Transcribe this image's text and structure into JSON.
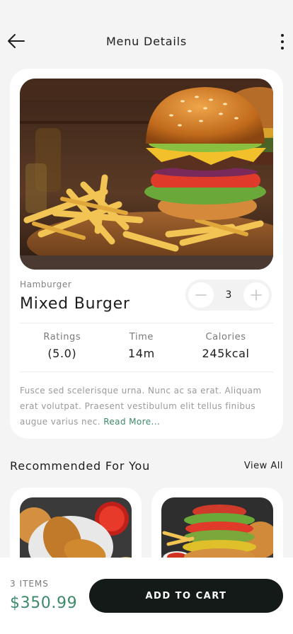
{
  "header": {
    "title": "Menu Details"
  },
  "item": {
    "category": "Hamburger",
    "name": "Mixed Burger",
    "quantity": "3",
    "stats": [
      {
        "label": "Ratings",
        "value": "(5.0)"
      },
      {
        "label": "Time",
        "value": "14m"
      },
      {
        "label": "Calories",
        "value": "245kcal"
      }
    ],
    "description": "Fusce sed scelerisque urna. Nunc ac sa erat. Aliquam erat volutpat. Praesent vestibulum elit tellus finibus augue varius nec.",
    "read_more": "Read More..."
  },
  "recommended": {
    "title": "Recommended For You",
    "view_all": "View All"
  },
  "cart": {
    "items_count": "3 ITEMS",
    "price": "$350.99",
    "button_label": "ADD TO CART"
  },
  "colors": {
    "accent": "#3d8a6b",
    "dark_button": "#141a17",
    "background": "#f4f4f4"
  },
  "icons": [
    "arrow-left-icon",
    "more-vertical-icon",
    "minus-icon",
    "plus-icon"
  ]
}
